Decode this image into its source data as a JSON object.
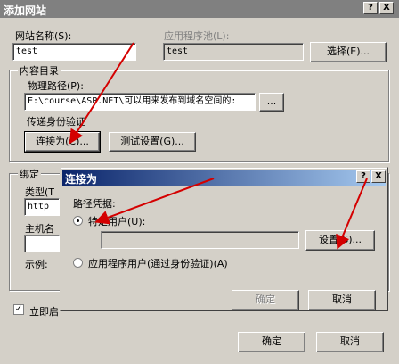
{
  "window": {
    "title": "添加网站",
    "help_btn": "?",
    "close_btn": "X"
  },
  "site": {
    "name_label": "网站名称(S):",
    "name_value": "test",
    "pool_label": "应用程序池(L):",
    "pool_value": "test",
    "select_btn": "选择(E)..."
  },
  "content": {
    "group_label": "内容目录",
    "path_label": "物理路径(P):",
    "path_value": "E:\\course\\ASP.NET\\可以用来发布到域名空间的:",
    "browse_btn": "...",
    "auth_label": "传递身份验证",
    "connect_btn": "连接为(C)...",
    "test_btn": "测试设置(G)..."
  },
  "binding": {
    "group_label": "绑定",
    "type_label": "类型(T",
    "type_value": "http",
    "host_label": "主机名",
    "example_label": "示例:"
  },
  "start_now_label": "立即启",
  "footer": {
    "ok_btn": "确定",
    "cancel_btn": "取消"
  },
  "connect_dialog": {
    "title": "连接为",
    "help_btn": "?",
    "close_btn": "X",
    "credentials_label": "路径凭据:",
    "specific_user_label": "特定用户(U):",
    "set_btn": "设置(S)...",
    "app_user_label": "应用程序用户(通过身份验证)(A)",
    "ok_btn": "确定",
    "cancel_btn": "取消"
  }
}
